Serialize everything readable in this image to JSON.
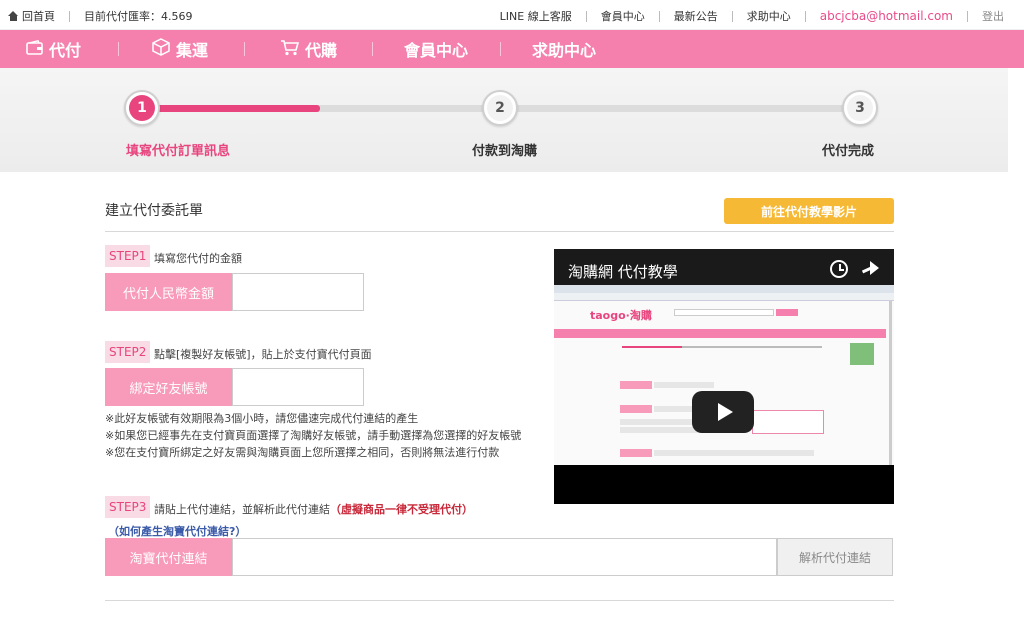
{
  "topbar": {
    "home_label": "回首頁",
    "rate_label": "目前代付匯率：4.569",
    "links": [
      "LINE 線上客服",
      "會員中心",
      "最新公告",
      "求助中心"
    ],
    "email": "abcjcba@hotmail.com",
    "logout": "登出"
  },
  "nav": {
    "items": [
      {
        "label": "代付",
        "icon": "wallet-icon"
      },
      {
        "label": "集運",
        "icon": "box-icon"
      },
      {
        "label": "代購",
        "icon": "cart-icon"
      },
      {
        "label": "會員中心",
        "icon": ""
      },
      {
        "label": "求助中心",
        "icon": ""
      }
    ]
  },
  "progress": {
    "current_step": 1,
    "fill_fraction": 0.25,
    "steps": [
      {
        "num": "1",
        "label": "填寫代付訂單訊息"
      },
      {
        "num": "2",
        "label": "付款到淘購"
      },
      {
        "num": "3",
        "label": "代付完成"
      }
    ]
  },
  "main": {
    "title": "建立代付委託單",
    "tutorial_button": "前往代付教學影片",
    "step1": {
      "tag": "STEP1",
      "desc": "填寫您代付的金額",
      "field_label": "代付人民幣金額",
      "value": ""
    },
    "step2": {
      "tag": "STEP2",
      "desc": "點擊[複製好友帳號]，貼上於支付寶代付頁面",
      "field_label": "綁定好友帳號",
      "value": "",
      "notes": [
        "※此好友帳號有效期限為3個小時，請您儘速完成代付連結的產生",
        "※如果您已經事先在支付寶頁面選擇了淘購好友帳號，請手動選擇為您選擇的好友帳號",
        "※您在支付寶所綁定之好友需與淘購頁面上您所選擇之相同，否則將無法進行付款"
      ]
    },
    "step3": {
      "tag": "STEP3",
      "desc": "請貼上代付連結，並解析此代付連結",
      "warning": "（虛擬商品一律不受理代付）",
      "howto": "（如何產生淘寶代付連結?）",
      "field_label": "淘寶代付連結",
      "value": "",
      "parse_button": "解析代付連結"
    }
  },
  "video": {
    "title": "淘購網 代付教學",
    "site_logo": "taogo·淘購"
  }
}
